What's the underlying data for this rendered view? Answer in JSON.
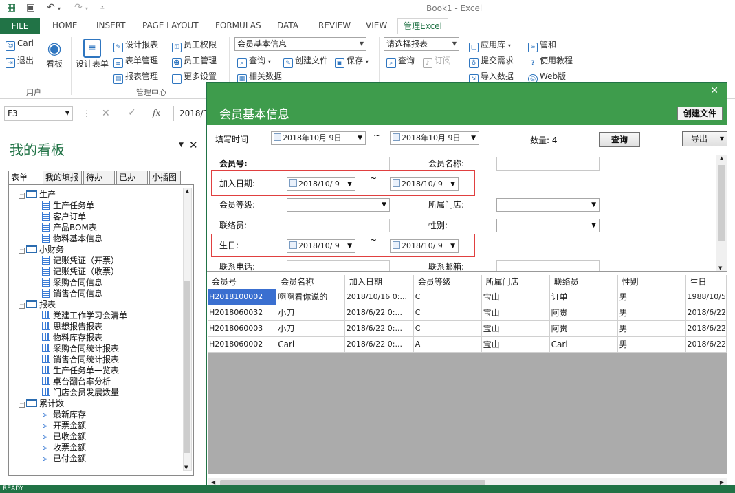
{
  "window": {
    "title": "Book1 - Excel"
  },
  "tabs": [
    "FILE",
    "HOME",
    "INSERT",
    "PAGE LAYOUT",
    "FORMULAS",
    "DATA",
    "REVIEW",
    "VIEW",
    "管理Excel"
  ],
  "ribbon": {
    "user": "Carl",
    "logout": "退出",
    "kanban": "看板",
    "design_form": "设计表单",
    "design_report": "设计报表",
    "form_manage": "表单管理",
    "report_manage": "报表管理",
    "emp_perm": "员工权限",
    "emp_manage": "员工管理",
    "more_settings": "更多设置",
    "group_user": "用户",
    "group_mgmt": "管理中心",
    "form_select": "会员基本信息",
    "query": "查询",
    "create_file": "创建文件",
    "save": "保存",
    "related_data": "相关数据",
    "report_select": "请选择报表",
    "report_query": "查询",
    "subscribe": "订阅",
    "app_store": "应用库",
    "submit_req": "提交需求",
    "import_data": "导入数据",
    "manage": "管和",
    "tutorial": "使用教程",
    "web": "Web版"
  },
  "formula_bar": {
    "name_box": "F3",
    "value": "2018/1"
  },
  "pane": {
    "title": "我的看板",
    "tabs": [
      "表单",
      "我的填报",
      "待办",
      "已办",
      "小插图"
    ],
    "tree": [
      {
        "label": "生产",
        "type": "folder"
      },
      {
        "label": "生产任务单",
        "type": "doc"
      },
      {
        "label": "客户订单",
        "type": "doc"
      },
      {
        "label": "产品BOM表",
        "type": "doc"
      },
      {
        "label": "物料基本信息",
        "type": "doc"
      },
      {
        "label": "小财务",
        "type": "folder"
      },
      {
        "label": "记账凭证（开票）",
        "type": "doc"
      },
      {
        "label": "记账凭证（收票）",
        "type": "doc"
      },
      {
        "label": "采购合同信息",
        "type": "doc"
      },
      {
        "label": "销售合同信息",
        "type": "doc"
      },
      {
        "label": "报表",
        "type": "folder"
      },
      {
        "label": "党建工作学习会清单",
        "type": "bar"
      },
      {
        "label": "思想报告报表",
        "type": "bar"
      },
      {
        "label": "物料库存报表",
        "type": "bar"
      },
      {
        "label": "采购合同统计报表",
        "type": "bar"
      },
      {
        "label": "销售合同统计报表",
        "type": "bar"
      },
      {
        "label": "生产任务单一览表",
        "type": "bar"
      },
      {
        "label": "桌台翻台率分析",
        "type": "bar"
      },
      {
        "label": "门店会员发展数量",
        "type": "bar"
      },
      {
        "label": "累计数",
        "type": "folder"
      },
      {
        "label": "最新库存",
        "type": "sig"
      },
      {
        "label": "开票金额",
        "type": "sig"
      },
      {
        "label": "已收金额",
        "type": "sig"
      },
      {
        "label": "收票金额",
        "type": "sig"
      },
      {
        "label": "已付金额",
        "type": "sig"
      }
    ]
  },
  "dialog": {
    "title": "会员基本信息",
    "create_file": "创建文件",
    "fill_time_label": "填写时间",
    "date_from": "2018年10月 9日",
    "tilde": "~",
    "date_to": "2018年10月 9日",
    "count_label": "数量: 4",
    "query_btn": "查询",
    "export_btn": "导出",
    "labels": {
      "member_no": "会员号:",
      "member_name": "会员名称:",
      "join_date": "加入日期:",
      "member_level": "会员等级:",
      "store": "所属门店:",
      "contact": "联络员:",
      "gender": "性别:",
      "birthday": "生日:",
      "phone": "联系电话:",
      "email": "联系邮箱:"
    },
    "short_date": "2018/10/ 9",
    "table": {
      "columns": [
        "会员号",
        "会员名称",
        "加入日期",
        "会员等级",
        "所属门店",
        "联络员",
        "性别",
        "生日"
      ],
      "rows": [
        [
          "H2018100002",
          "啊啊看你说的",
          "2018/10/16 0:...",
          "C",
          "宝山",
          "订单",
          "男",
          "1988/10/5"
        ],
        [
          "H2018060032",
          "小刀",
          "2018/6/22 0:...",
          "C",
          "宝山",
          "阿贵",
          "男",
          "2018/6/22"
        ],
        [
          "H2018060003",
          "小刀",
          "2018/6/22 0:...",
          "C",
          "宝山",
          "阿贵",
          "男",
          "2018/6/22"
        ],
        [
          "H2018060002",
          "Carl",
          "2018/6/22 0:...",
          "A",
          "宝山",
          "Carl",
          "男",
          "2018/6/22"
        ]
      ]
    }
  },
  "status": {
    "text": "READY"
  }
}
